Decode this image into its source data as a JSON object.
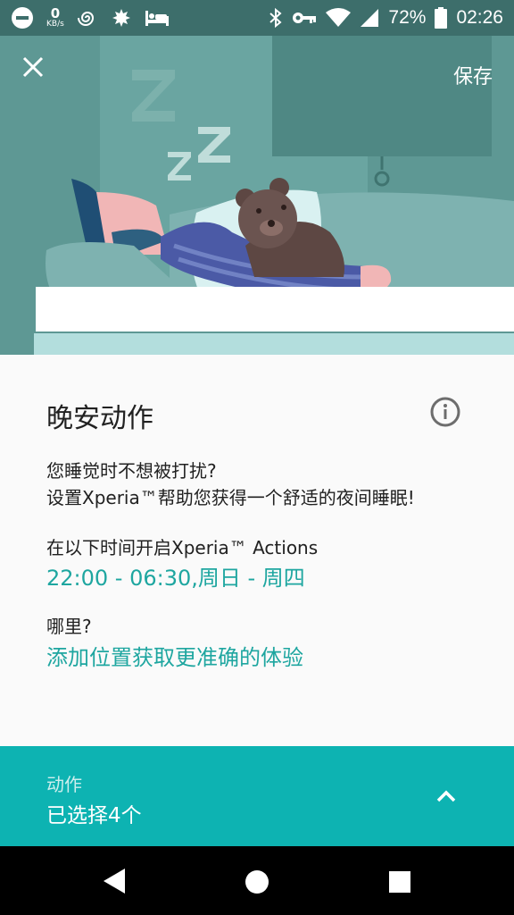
{
  "status_bar": {
    "net_speed_value": "0",
    "net_speed_unit": "KB/s",
    "battery_percent": "72%",
    "time": "02:26",
    "icons_left": [
      "dnd-icon",
      "net-speed",
      "swirl-icon",
      "leaf-icon",
      "bed-icon"
    ],
    "icons_right": [
      "bluetooth-icon",
      "key-icon",
      "wifi-icon",
      "signal-icon",
      "battery-icon"
    ]
  },
  "header": {
    "close_icon": "close-icon",
    "save_label": "保存"
  },
  "main": {
    "title": "晚安动作",
    "info_icon": "info-icon",
    "description_line1": "您睡觉时不想被打扰?",
    "description_line2": "设置Xperia™帮助您获得一个舒适的夜间睡眠!",
    "schedule_label": "在以下时间开启Xperia™ Actions",
    "schedule_value": "22:00 - 06:30,周日 - 周四",
    "location_label": "哪里?",
    "location_link": "添加位置获取更准确的体验"
  },
  "actions_panel": {
    "label": "动作",
    "value": "已选择4个",
    "expand_icon": "chevron-up-icon"
  },
  "nav": {
    "back_icon": "back-icon",
    "home_icon": "home-icon",
    "recents_icon": "recents-icon"
  },
  "colors": {
    "accent": "#1ea6a0",
    "panel": "#0db3b2",
    "hero_bg": "#5e9894",
    "status_bar": "#3d6e6b"
  }
}
